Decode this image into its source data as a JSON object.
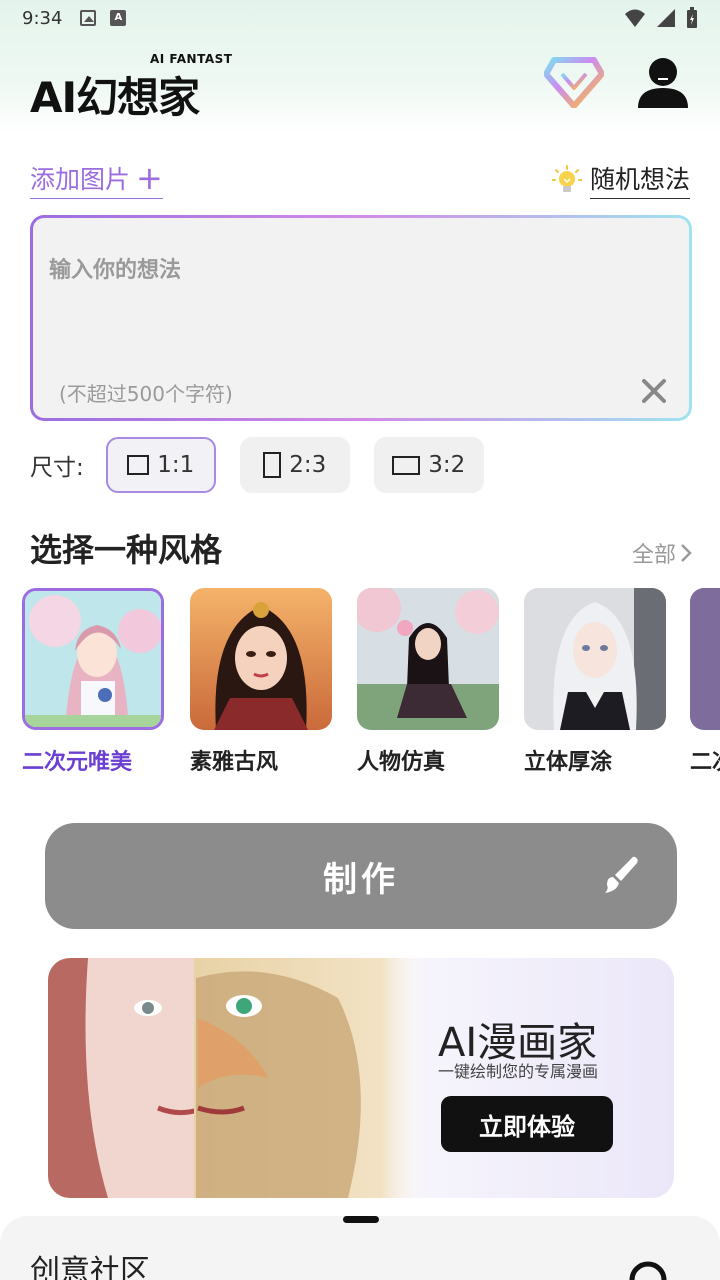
{
  "status_bar": {
    "time": "9:34"
  },
  "header": {
    "logo_sub": "AI FANTAST",
    "logo_main": "AI幻想家"
  },
  "input_section": {
    "add_image_label": "添加图片",
    "add_image_plus": "+",
    "random_idea_label": "随机想法",
    "placeholder": "输入你的想法",
    "limit_hint": "(不超过500个字符)"
  },
  "size": {
    "label": "尺寸:",
    "options": [
      {
        "label": "1:1",
        "selected": true
      },
      {
        "label": "2:3",
        "selected": false
      },
      {
        "label": "3:2",
        "selected": false
      }
    ]
  },
  "styles": {
    "title": "选择一种风格",
    "all_label": "全部",
    "items": [
      {
        "name": "二次元唯美",
        "selected": true
      },
      {
        "name": "素雅古风",
        "selected": false
      },
      {
        "name": "人物仿真",
        "selected": false
      },
      {
        "name": "立体厚涂",
        "selected": false
      },
      {
        "name": "二次",
        "selected": false
      }
    ]
  },
  "make_button": {
    "label": "制作"
  },
  "banner": {
    "title": "AI漫画家",
    "subtitle": "一键绘制您的专属漫画",
    "cta": "立即体验"
  },
  "community": {
    "title": "创意社区"
  },
  "colors": {
    "accent": "#9b6de0",
    "make_button_bg": "#8c8c8c",
    "prompt_bg": "#f2f2f2"
  }
}
